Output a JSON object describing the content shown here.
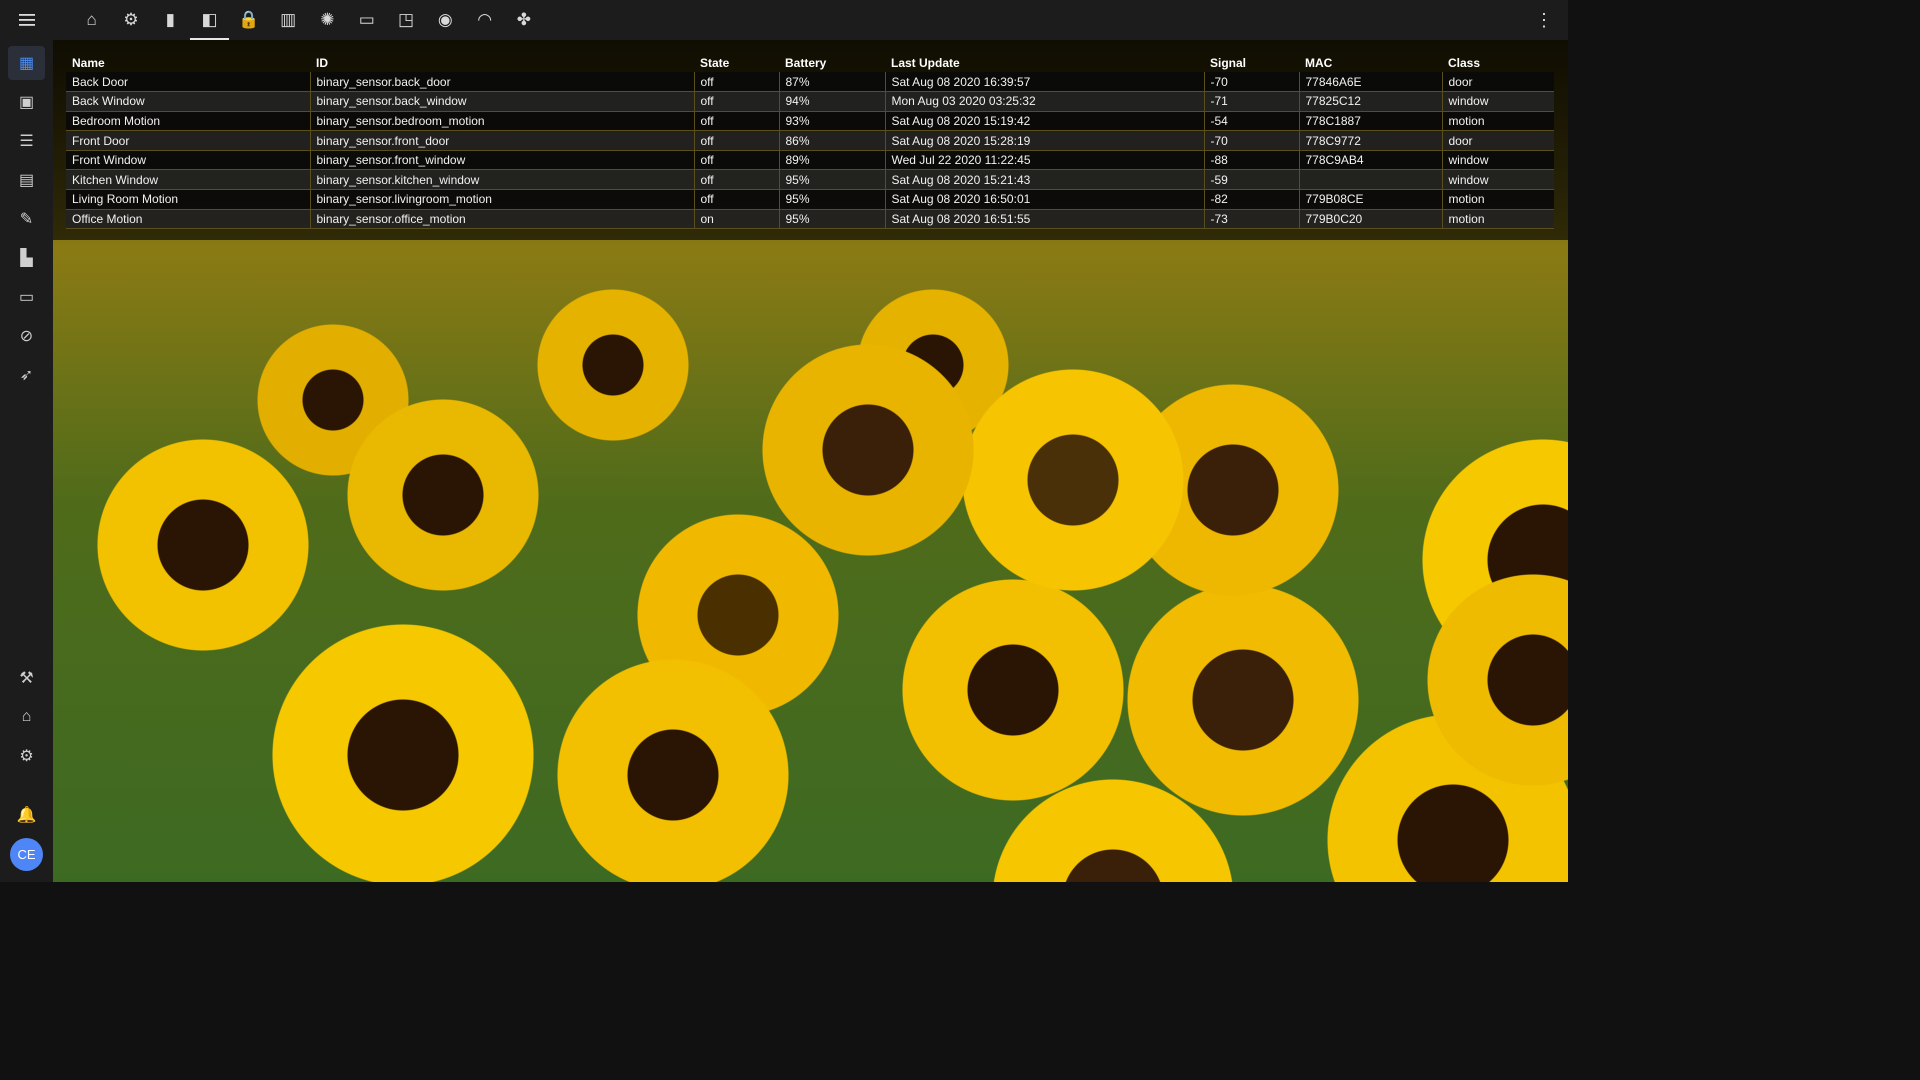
{
  "topbar": {
    "menu_icon": "menu-icon",
    "tabs": [
      {
        "icon": "home-icon",
        "glyph": "⌂"
      },
      {
        "icon": "settings-icon",
        "glyph": "⚙"
      },
      {
        "icon": "battery-icon",
        "glyph": "▮"
      },
      {
        "icon": "door-icon",
        "glyph": "◧"
      },
      {
        "icon": "lock-icon",
        "glyph": "🔒"
      },
      {
        "icon": "window-icon",
        "glyph": "▥"
      },
      {
        "icon": "lightbulb-icon",
        "glyph": "✺"
      },
      {
        "icon": "tv-icon",
        "glyph": "▭"
      },
      {
        "icon": "cast-icon",
        "glyph": "◳"
      },
      {
        "icon": "speaker-icon",
        "glyph": "◉"
      },
      {
        "icon": "signal-icon",
        "glyph": "◠"
      },
      {
        "icon": "fan-icon",
        "glyph": "✤"
      }
    ],
    "active_tab": 3,
    "overflow_icon": "dots-vertical-icon"
  },
  "sidebar": {
    "items": [
      {
        "icon": "dashboard-icon",
        "glyph": "▦",
        "active": true
      },
      {
        "icon": "account-box-icon",
        "glyph": "▣"
      },
      {
        "icon": "list-icon",
        "glyph": "☰"
      },
      {
        "icon": "chart-icon",
        "glyph": "▤"
      },
      {
        "icon": "wrench-icon",
        "glyph": "✎"
      },
      {
        "icon": "hacs-store-icon",
        "glyph": "▙"
      },
      {
        "icon": "console-icon",
        "glyph": "▭"
      },
      {
        "icon": "compass-icon",
        "glyph": "⊘"
      },
      {
        "icon": "rocket-icon",
        "glyph": "➶"
      }
    ],
    "bottom_items": [
      {
        "icon": "hammer-icon",
        "glyph": "⚒"
      },
      {
        "icon": "home-assistant-icon",
        "glyph": "⌂"
      },
      {
        "icon": "cog-icon",
        "glyph": "⚙"
      },
      {
        "icon": "bell-icon",
        "glyph": "🔔"
      }
    ],
    "avatar_initials": "CE"
  },
  "table": {
    "headers": [
      "Name",
      "ID",
      "State",
      "Battery",
      "Last Update",
      "Signal",
      "MAC",
      "Class"
    ],
    "rows": [
      [
        "Back Door",
        "binary_sensor.back_door",
        "off",
        "87%",
        "Sat Aug 08 2020 16:39:57",
        "-70",
        "77846A6E",
        "door"
      ],
      [
        "Back Window",
        "binary_sensor.back_window",
        "off",
        "94%",
        "Mon Aug 03 2020 03:25:32",
        "-71",
        "77825C12",
        "window"
      ],
      [
        "Bedroom Motion",
        "binary_sensor.bedroom_motion",
        "off",
        "93%",
        "Sat Aug 08 2020 15:19:42",
        "-54",
        "778C1887",
        "motion"
      ],
      [
        "Front Door",
        "binary_sensor.front_door",
        "off",
        "86%",
        "Sat Aug 08 2020 15:28:19",
        "-70",
        "778C9772",
        "door"
      ],
      [
        "Front Window",
        "binary_sensor.front_window",
        "off",
        "89%",
        "Wed Jul 22 2020 11:22:45",
        "-88",
        "778C9AB4",
        "window"
      ],
      [
        "Kitchen Window",
        "binary_sensor.kitchen_window",
        "off",
        "95%",
        "Sat Aug 08 2020 15:21:43",
        "-59",
        "",
        "window"
      ],
      [
        "Living Room Motion",
        "binary_sensor.livingroom_motion",
        "off",
        "95%",
        "Sat Aug 08 2020 16:50:01",
        "-82",
        "779B08CE",
        "motion"
      ],
      [
        "Office Motion",
        "binary_sensor.office_motion",
        "on",
        "95%",
        "Sat Aug 08 2020 16:51:55",
        "-73",
        "779B0C20",
        "motion"
      ]
    ]
  }
}
